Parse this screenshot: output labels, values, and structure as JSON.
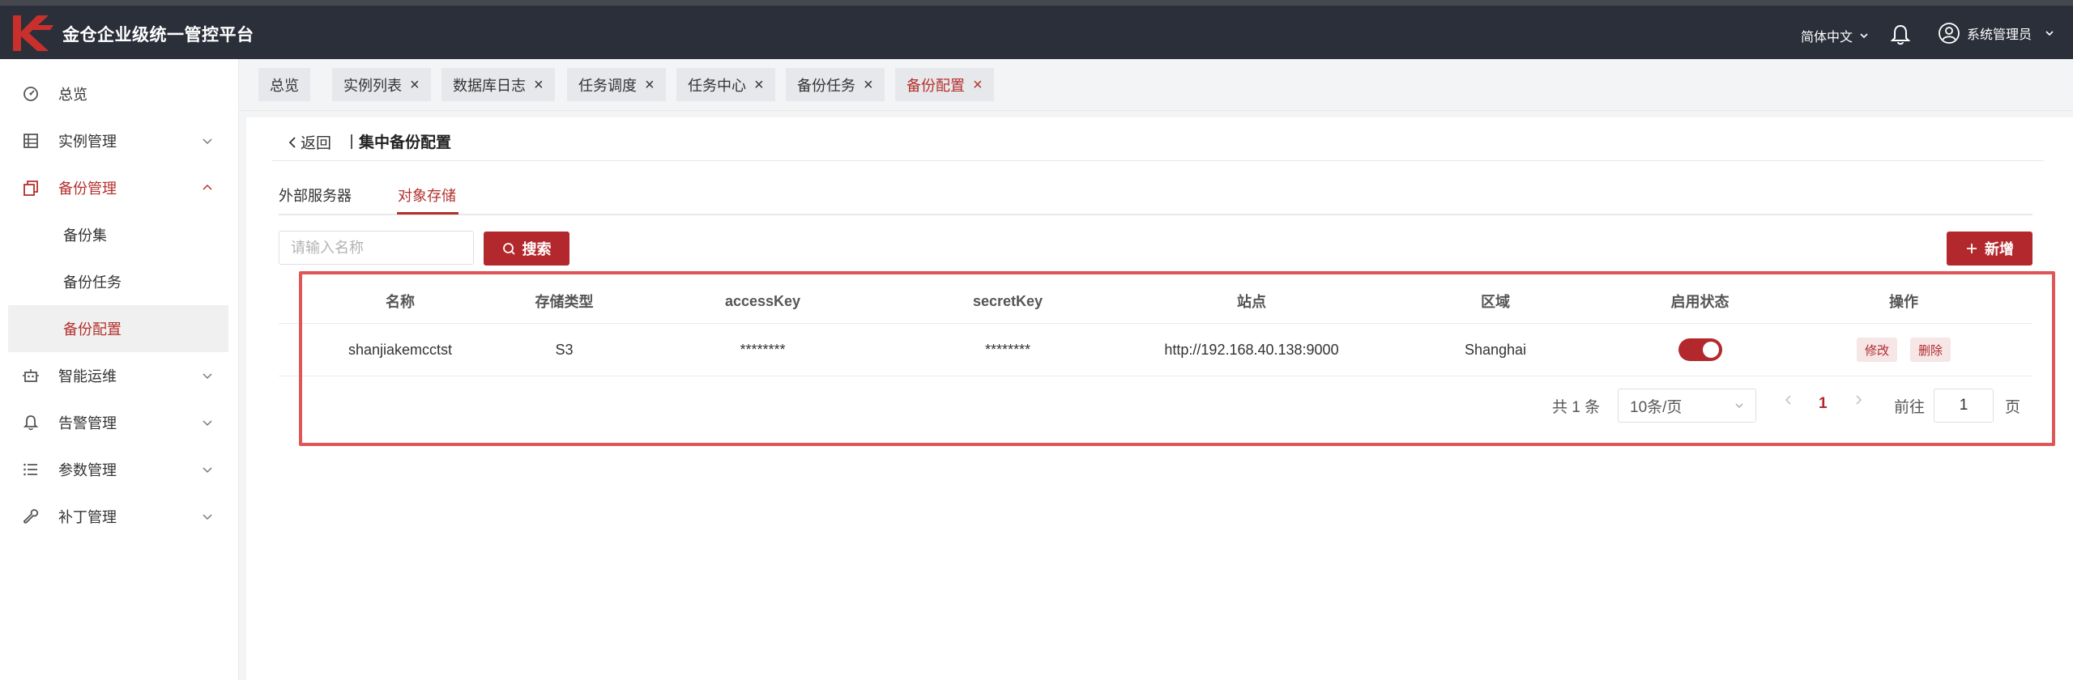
{
  "app": {
    "title": "金仓企业级统一管控平台",
    "brand_color": "#b3282c",
    "language": "简体中文",
    "user": "系统管理员"
  },
  "sidebar": {
    "items": [
      {
        "label": "总览",
        "icon": "dashboard-icon"
      },
      {
        "label": "实例管理",
        "icon": "instance-icon"
      },
      {
        "label": "备份管理",
        "icon": "backup-icon",
        "expanded": true
      },
      {
        "label": "智能运维",
        "icon": "robot-icon"
      },
      {
        "label": "告警管理",
        "icon": "bell-icon"
      },
      {
        "label": "参数管理",
        "icon": "list-icon"
      },
      {
        "label": "补丁管理",
        "icon": "wrench-icon"
      }
    ],
    "backup_children": [
      "备份集",
      "备份任务",
      "备份配置"
    ]
  },
  "tabs": [
    {
      "label": "总览",
      "closable": false
    },
    {
      "label": "实例列表",
      "closable": true
    },
    {
      "label": "数据库日志",
      "closable": true
    },
    {
      "label": "任务调度",
      "closable": true
    },
    {
      "label": "任务中心",
      "closable": true
    },
    {
      "label": "备份任务",
      "closable": true
    },
    {
      "label": "备份配置",
      "closable": true,
      "active": true
    }
  ],
  "page": {
    "back_label": "返回",
    "title": "集中备份配置",
    "subtabs": [
      "外部服务器",
      "对象存储"
    ],
    "active_subtab": "对象存储"
  },
  "toolbar": {
    "search_placeholder": "请输入名称",
    "search_label": "搜索",
    "add_label": "新增"
  },
  "table": {
    "columns": [
      "名称",
      "存储类型",
      "accessKey",
      "secretKey",
      "站点",
      "区域",
      "启用状态",
      "操作"
    ],
    "rows": [
      {
        "name": "shanjiakemcctst",
        "type": "S3",
        "accessKey": "********",
        "secretKey": "********",
        "site": "http://192.168.40.138:9000",
        "region": "Shanghai",
        "enabled": true,
        "edit_label": "修改",
        "delete_label": "删除"
      }
    ]
  },
  "pagination": {
    "total_text": "共 1 条",
    "page_size": "10条/页",
    "current_page": "1",
    "goto_label": "前往",
    "goto_value": "1",
    "page_unit": "页"
  }
}
